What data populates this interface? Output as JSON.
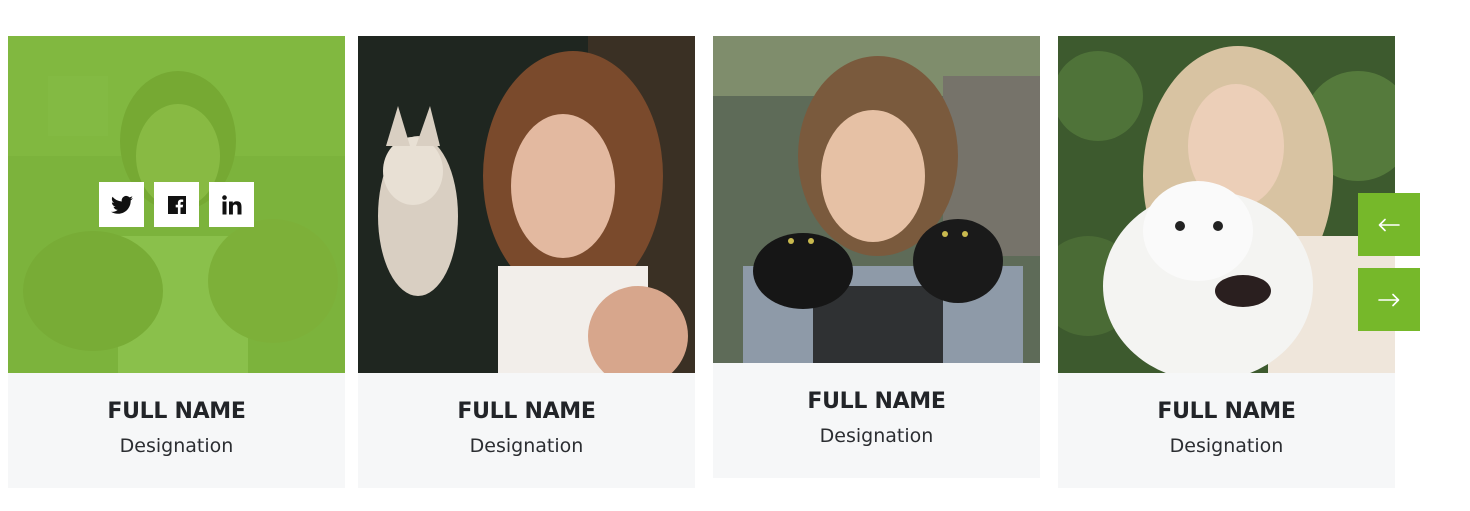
{
  "accent_color": "#76b82a",
  "team": [
    {
      "name": "FULL NAME",
      "designation": "Designation",
      "photo": "girl-with-two-small-dogs"
    },
    {
      "name": "FULL NAME",
      "designation": "Designation",
      "photo": "woman-holding-chihuahua"
    },
    {
      "name": "FULL NAME",
      "designation": "Designation",
      "photo": "girl-holding-black-kittens"
    },
    {
      "name": "FULL NAME",
      "designation": "Designation",
      "photo": "woman-with-white-samoyed"
    }
  ],
  "hover_overlay_social": [
    "twitter-icon",
    "facebook-icon",
    "linkedin-icon"
  ],
  "carousel_nav": [
    "arrow-left-icon",
    "arrow-right-icon"
  ]
}
